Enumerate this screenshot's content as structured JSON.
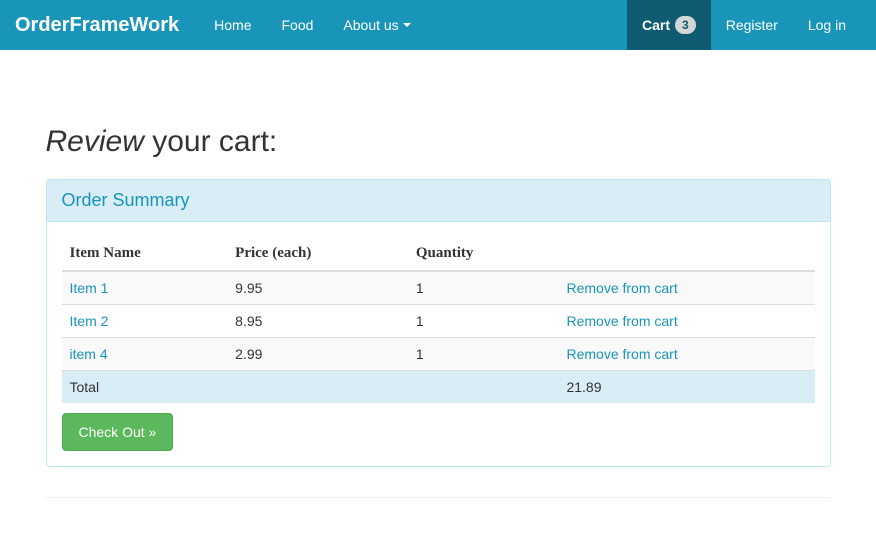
{
  "brand": "OrderFrameWork",
  "nav": {
    "home": "Home",
    "food": "Food",
    "about": "About us",
    "cart": "Cart",
    "cart_count": "3",
    "register": "Register",
    "login": "Log in"
  },
  "header": {
    "em": "Review",
    "rest": " your cart:"
  },
  "panel": {
    "title": "Order Summary"
  },
  "table": {
    "th": {
      "name": "Item Name",
      "price": "Price (each)",
      "qty": "Quantity"
    },
    "rows": [
      {
        "name": "Item 1",
        "price": "9.95",
        "qty": "1",
        "action": "Remove from cart"
      },
      {
        "name": "Item 2",
        "price": "8.95",
        "qty": "1",
        "action": "Remove from cart"
      },
      {
        "name": "item 4",
        "price": "2.99",
        "qty": "1",
        "action": "Remove from cart"
      }
    ],
    "total_label": "Total",
    "total_value": "21.89"
  },
  "checkout": "Check Out »"
}
